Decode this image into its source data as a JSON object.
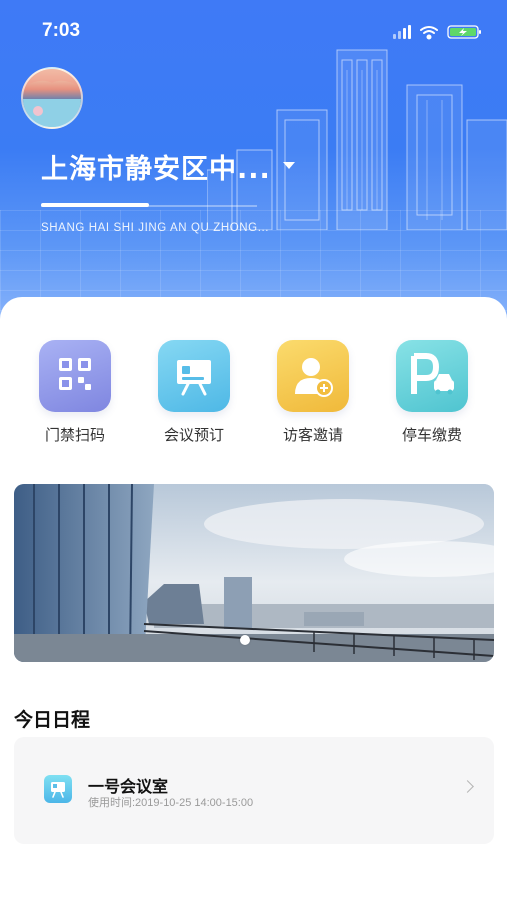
{
  "status_bar": {
    "time": "7:03"
  },
  "header": {
    "location_title": "上海市静安区中...",
    "location_subtitle": "SHANG HAI SHI JING AN QU ZHONG..."
  },
  "quick_actions": [
    {
      "label": "门禁扫码",
      "icon": "qr-code-icon"
    },
    {
      "label": "会议预订",
      "icon": "presentation-board-icon"
    },
    {
      "label": "访客邀请",
      "icon": "add-user-icon"
    },
    {
      "label": "停车缴费",
      "icon": "parking-icon"
    }
  ],
  "banner": {
    "page_index": 1,
    "page_count": 1
  },
  "schedule": {
    "section_title": "今日日程",
    "items": [
      {
        "title": "一号会议室",
        "time": "使用时间:2019-10-25 14:00-15:00"
      }
    ]
  },
  "colors": {
    "brand_blue": "#3b7cf4",
    "qr_icon": "#8f95e8",
    "meeting_icon": "#58c3ea",
    "visitor_icon": "#f5c542",
    "parking_icon": "#5ecdd7"
  }
}
